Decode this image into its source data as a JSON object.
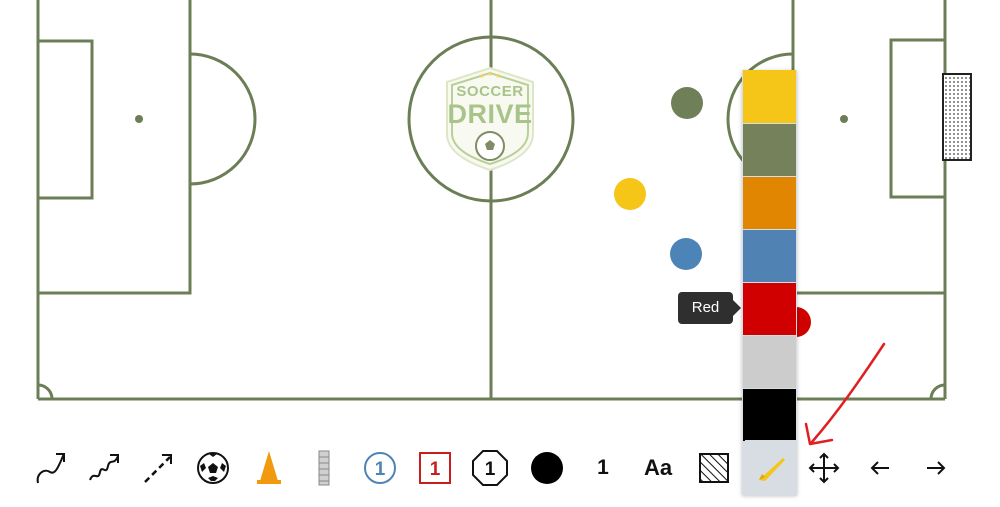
{
  "field": {
    "line_color": "#6b7e56",
    "logo": {
      "line1": "SOCCER",
      "line2": "DRIVE"
    }
  },
  "players": [
    {
      "color_name": "olive",
      "color": "#6f7f57"
    },
    {
      "color_name": "yellow",
      "color": "#f5c518"
    },
    {
      "color_name": "blue",
      "color": "#4c84b8"
    },
    {
      "color_name": "red",
      "color": "#d00000"
    }
  ],
  "color_palette": {
    "swatches": [
      {
        "name": "Yellow",
        "color": "#f5c518"
      },
      {
        "name": "Olive",
        "color": "#74815a"
      },
      {
        "name": "Orange",
        "color": "#e08600"
      },
      {
        "name": "Blue",
        "color": "#5083b4"
      },
      {
        "name": "Red",
        "color": "#d10000"
      },
      {
        "name": "Light Gray",
        "color": "#cccccc"
      },
      {
        "name": "Black",
        "color": "#000000"
      }
    ],
    "tooltip": "Red"
  },
  "toolbar": {
    "tools": [
      {
        "name": "curved-arrow-tool",
        "icon": "curved-arrow-icon"
      },
      {
        "name": "dribble-arrow-tool",
        "icon": "wavy-arrow-icon"
      },
      {
        "name": "dashed-arrow-tool",
        "icon": "dashed-arrow-icon"
      },
      {
        "name": "ball-tool",
        "icon": "soccer-ball-icon"
      },
      {
        "name": "cone-tool",
        "icon": "cone-icon"
      },
      {
        "name": "ladder-tool",
        "icon": "ladder-icon"
      },
      {
        "name": "player-circle-tool",
        "icon": "circle-number-icon",
        "label": "1"
      },
      {
        "name": "player-square-tool",
        "icon": "square-number-icon",
        "label": "1"
      },
      {
        "name": "player-octagon-tool",
        "icon": "octagon-number-icon",
        "label": "1"
      },
      {
        "name": "dot-tool",
        "icon": "filled-circle-icon"
      },
      {
        "name": "number-tool",
        "label": "1"
      },
      {
        "name": "text-tool",
        "label": "Aa"
      },
      {
        "name": "area-tool",
        "icon": "hatched-square-icon"
      },
      {
        "name": "color-tool",
        "icon": "pen-icon",
        "active": true,
        "color": "#f5c518"
      },
      {
        "name": "move-tool",
        "icon": "move-icon"
      },
      {
        "name": "undo-tool",
        "icon": "arrow-left-icon"
      },
      {
        "name": "redo-tool",
        "icon": "arrow-right-icon"
      }
    ]
  }
}
